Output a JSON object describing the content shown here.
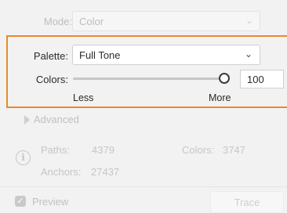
{
  "mode": {
    "label": "Mode:",
    "value": "Color"
  },
  "palette": {
    "label": "Palette:",
    "value": "Full Tone"
  },
  "colors": {
    "label": "Colors:",
    "value": "100",
    "slider_fraction": 1.0,
    "less_label": "Less",
    "more_label": "More"
  },
  "advanced": {
    "label": "Advanced"
  },
  "stats": {
    "paths_label": "Paths:",
    "paths_value": "4379",
    "colors_label": "Colors:",
    "colors_value": "3747",
    "anchors_label": "Anchors:",
    "anchors_value": "27437"
  },
  "preview": {
    "label": "Preview",
    "checked": true
  },
  "trace": {
    "label": "Trace"
  },
  "icons": {
    "chevron": "chevron-down-icon",
    "info": "info-icon",
    "check": "checkbox-check-icon",
    "disclosure": "disclosure-triangle-icon"
  },
  "colors_theme": {
    "highlight": "#e88a2a"
  }
}
